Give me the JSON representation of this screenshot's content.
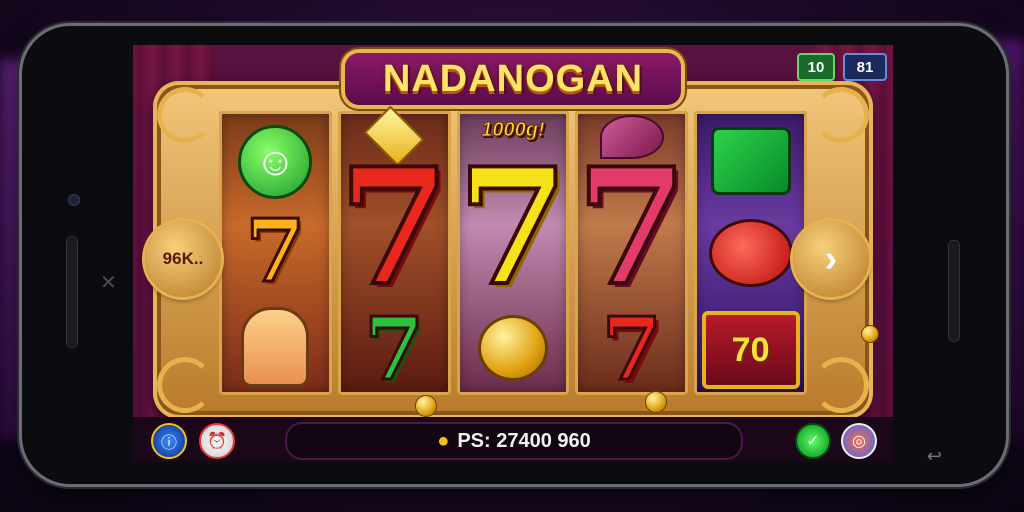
{
  "game": {
    "title": "NADANOGAN",
    "badges": {
      "left": "10",
      "right": "81"
    },
    "bet_button_label": "96K..",
    "next_button_icon": "chevron-right-icon",
    "balance_text": "PS: 27400 960",
    "reels": [
      {
        "top": "smiley-face-icon",
        "middle": "7",
        "bottom": "cartoon-character-icon"
      },
      {
        "top": "gem-icon",
        "middle": "7",
        "bottom": "7"
      },
      {
        "top": "1000g!",
        "middle": "7",
        "bottom": "gold-bell-icon"
      },
      {
        "top": "leaf-icon",
        "middle": "7",
        "bottom": "7"
      },
      {
        "top": "flag-icon",
        "middle": "red-swirl-icon",
        "bottom": "70"
      }
    ],
    "bottom_left_buttons": [
      "info-icon",
      "alarm-icon"
    ],
    "bottom_right_buttons": [
      "check-icon",
      "settings-icon"
    ]
  }
}
